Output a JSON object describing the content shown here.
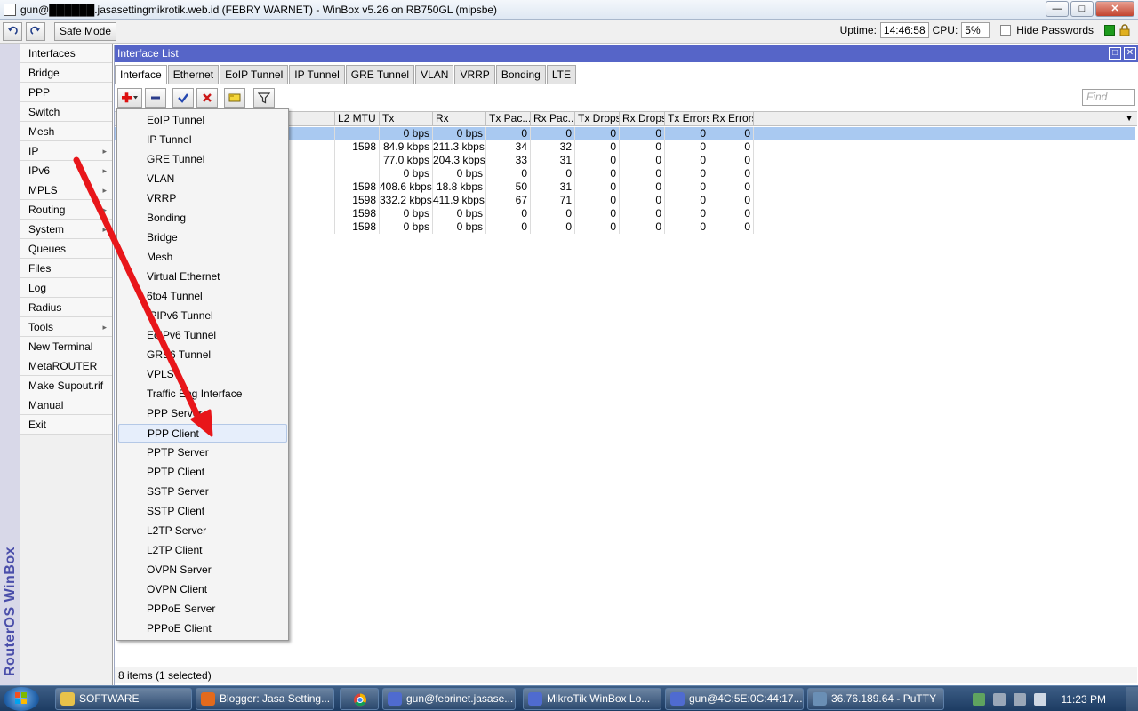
{
  "window": {
    "title": "gun@██████.jasasettingmikrotik.web.id (FEBRY WARNET) - WinBox v5.26 on RB750GL (mipsbe)"
  },
  "toolbar": {
    "safe_mode_label": "Safe Mode",
    "uptime_label": "Uptime:",
    "uptime_value": "14:46:58",
    "cpu_label": "CPU:",
    "cpu_value": "5%",
    "hide_passwords_label": "Hide Passwords"
  },
  "banner": {
    "brand": "RouterOS WinBox"
  },
  "left_menu": {
    "items": [
      {
        "label": "Interfaces",
        "submenu": false
      },
      {
        "label": "Bridge",
        "submenu": false
      },
      {
        "label": "PPP",
        "submenu": false
      },
      {
        "label": "Switch",
        "submenu": false
      },
      {
        "label": "Mesh",
        "submenu": false
      },
      {
        "label": "IP",
        "submenu": true
      },
      {
        "label": "IPv6",
        "submenu": true
      },
      {
        "label": "MPLS",
        "submenu": true
      },
      {
        "label": "Routing",
        "submenu": true
      },
      {
        "label": "System",
        "submenu": true
      },
      {
        "label": "Queues",
        "submenu": false
      },
      {
        "label": "Files",
        "submenu": false
      },
      {
        "label": "Log",
        "submenu": false
      },
      {
        "label": "Radius",
        "submenu": false
      },
      {
        "label": "Tools",
        "submenu": true
      },
      {
        "label": "New Terminal",
        "submenu": false
      },
      {
        "label": "MetaROUTER",
        "submenu": false
      },
      {
        "label": "Make Supout.rif",
        "submenu": false
      },
      {
        "label": "Manual",
        "submenu": false
      },
      {
        "label": "Exit",
        "submenu": false
      }
    ]
  },
  "interface_list": {
    "title": "Interface List",
    "tabs": [
      "Interface",
      "Ethernet",
      "EoIP Tunnel",
      "IP Tunnel",
      "GRE Tunnel",
      "VLAN",
      "VRRP",
      "Bonding",
      "LTE"
    ],
    "active_tab": "Interface",
    "find_placeholder": "Find",
    "columns": [
      "L2 MTU",
      "Tx",
      "Rx",
      "Tx Pac...",
      "Rx Pac...",
      "Tx Drops",
      "Rx Drops",
      "Tx Errors",
      "Rx Errors"
    ],
    "rows": [
      [
        "",
        "0 bps",
        "0 bps",
        "0",
        "0",
        "0",
        "0",
        "0",
        "0"
      ],
      [
        "1598",
        "84.9 kbps",
        "211.3 kbps",
        "34",
        "32",
        "0",
        "0",
        "0",
        "0"
      ],
      [
        "",
        "77.0 kbps",
        "204.3 kbps",
        "33",
        "31",
        "0",
        "0",
        "0",
        "0"
      ],
      [
        "",
        "0 bps",
        "0 bps",
        "0",
        "0",
        "0",
        "0",
        "0",
        "0"
      ],
      [
        "1598",
        "408.6 kbps",
        "18.8 kbps",
        "50",
        "31",
        "0",
        "0",
        "0",
        "0"
      ],
      [
        "1598",
        "332.2 kbps",
        "411.9 kbps",
        "67",
        "71",
        "0",
        "0",
        "0",
        "0"
      ],
      [
        "1598",
        "0 bps",
        "0 bps",
        "0",
        "0",
        "0",
        "0",
        "0",
        "0"
      ],
      [
        "1598",
        "0 bps",
        "0 bps",
        "0",
        "0",
        "0",
        "0",
        "0",
        "0"
      ]
    ],
    "status": "8 items (1 selected)"
  },
  "add_menu": {
    "items": [
      "EoIP Tunnel",
      "IP Tunnel",
      "GRE Tunnel",
      "VLAN",
      "VRRP",
      "Bonding",
      "Bridge",
      "Mesh",
      "Virtual Ethernet",
      "6to4 Tunnel",
      "IPIPv6 Tunnel",
      "EoIPv6 Tunnel",
      "GRE6 Tunnel",
      "VPLS",
      "Traffic Eng Interface",
      "PPP Server",
      "PPP Client",
      "PPTP Server",
      "PPTP Client",
      "SSTP Server",
      "SSTP Client",
      "L2TP Server",
      "L2TP Client",
      "OVPN Server",
      "OVPN Client",
      "PPPoE Server",
      "PPPoE Client"
    ],
    "highlighted": "PPP Client"
  },
  "taskbar": {
    "tasks": [
      {
        "label": "SOFTWARE",
        "icon": "folder-icon"
      },
      {
        "label": "Blogger: Jasa Setting...",
        "icon": "firefox-icon"
      },
      {
        "label": "gun@febrinet.jasase...",
        "icon": "winbox-icon"
      },
      {
        "label": "MikroTik WinBox Lo...",
        "icon": "winbox-icon"
      },
      {
        "label": "gun@4C:5E:0C:44:17...",
        "icon": "winbox-icon"
      },
      {
        "label": "36.76.189.64 - PuTTY",
        "icon": "putty-icon"
      }
    ],
    "clock": "11:23 PM"
  },
  "colors": {
    "window_title_blue": "#5665c8",
    "selected_row": "#a9c9f1",
    "annotation_red": "#e8161a",
    "banner_text": "#4a4eaa"
  }
}
